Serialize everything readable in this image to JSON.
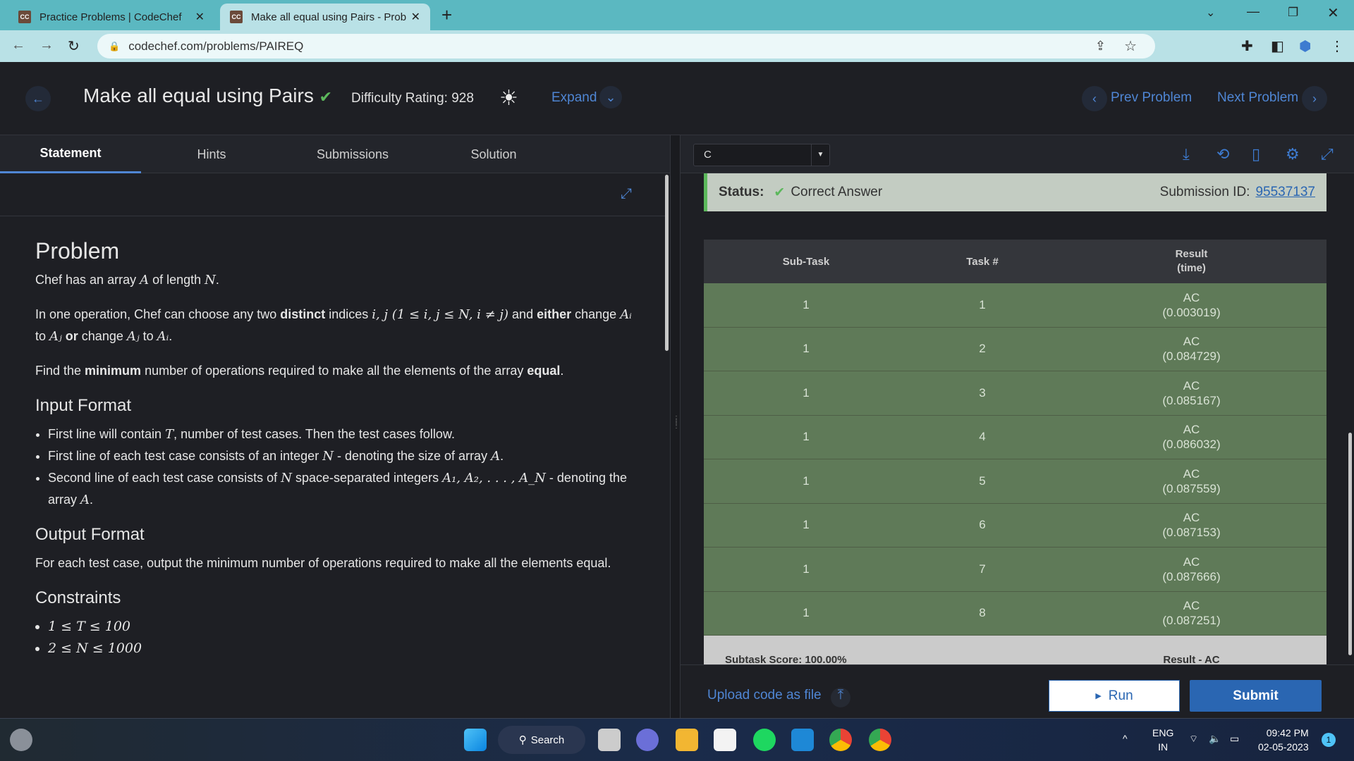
{
  "browser": {
    "tabs": [
      {
        "label": "Practice Problems | CodeChef",
        "favicon": "CC"
      },
      {
        "label": "Make all equal using Pairs - Probl",
        "favicon": "CC"
      }
    ],
    "new_tab": "+",
    "url": "codechef.com/problems/PAIREQ",
    "window_controls": [
      "chevron-down",
      "minimize",
      "restore",
      "close"
    ]
  },
  "header": {
    "title": "Make all equal using Pairs",
    "solved": "✔",
    "difficulty": "Difficulty Rating: 928",
    "expand": "Expand",
    "prev": "Prev Problem",
    "next": "Next Problem"
  },
  "left_tabs": [
    {
      "label": "Statement",
      "active": true
    },
    {
      "label": "Hints"
    },
    {
      "label": "Submissions"
    },
    {
      "label": "Solution"
    }
  ],
  "statement": {
    "problem_heading": "Problem",
    "paragraphs": [
      [
        {
          "t": "Chef has an array "
        },
        {
          "t": "A",
          "s": "m"
        },
        {
          "t": " of length "
        },
        {
          "t": "N",
          "s": "m"
        },
        {
          "t": "."
        }
      ],
      [
        {
          "t": "In one operation, Chef can choose any two "
        },
        {
          "t": "distinct",
          "s": "b"
        },
        {
          "t": " indices "
        },
        {
          "t": "i, j (1 ≤ i, j ≤ N, i ≠ j)",
          "s": "m"
        },
        {
          "t": " and "
        },
        {
          "t": "either",
          "s": "b"
        },
        {
          "t": " change "
        },
        {
          "t": "Aᵢ",
          "s": "m"
        },
        {
          "t": " to "
        },
        {
          "t": "Aⱼ",
          "s": "m"
        },
        {
          "t": " "
        },
        {
          "t": "or",
          "s": "b"
        },
        {
          "t": " change "
        },
        {
          "t": "Aⱼ",
          "s": "m"
        },
        {
          "t": " to "
        },
        {
          "t": "Aᵢ",
          "s": "m"
        },
        {
          "t": "."
        }
      ],
      [
        {
          "t": "Find the "
        },
        {
          "t": "minimum",
          "s": "b"
        },
        {
          "t": " number of operations required to make all the elements of the array "
        },
        {
          "t": "equal",
          "s": "b"
        },
        {
          "t": "."
        }
      ]
    ],
    "input_heading": "Input Format",
    "input_items": [
      [
        {
          "t": "First line will contain "
        },
        {
          "t": "T",
          "s": "m"
        },
        {
          "t": ", number of test cases. Then the test cases follow."
        }
      ],
      [
        {
          "t": "First line of each test case consists of an integer "
        },
        {
          "t": "N",
          "s": "m"
        },
        {
          "t": " - denoting the size of array "
        },
        {
          "t": "A",
          "s": "m"
        },
        {
          "t": "."
        }
      ],
      [
        {
          "t": "Second line of each test case consists of "
        },
        {
          "t": "N",
          "s": "m"
        },
        {
          "t": " space-separated integers "
        },
        {
          "t": "A₁, A₂, . . . , A_N",
          "s": "m"
        },
        {
          "t": " - denoting the array "
        },
        {
          "t": "A",
          "s": "m"
        },
        {
          "t": "."
        }
      ]
    ],
    "output_heading": "Output Format",
    "output_text": "For each test case, output the minimum number of operations required to make all the elements equal.",
    "constraints_heading": "Constraints",
    "constraints": [
      "1 ≤ T ≤ 100",
      "2 ≤ N ≤ 1000"
    ]
  },
  "editor": {
    "language": "C"
  },
  "result": {
    "status_label": "Status:",
    "status": "Correct Answer",
    "submission_label": "Submission ID:",
    "submission_id": "95537137",
    "headers": [
      "Sub-Task",
      "Task #",
      "Result\n(time)"
    ],
    "rows": [
      [
        "1",
        "1",
        "AC",
        "(0.003019)"
      ],
      [
        "1",
        "2",
        "AC",
        "(0.084729)"
      ],
      [
        "1",
        "3",
        "AC",
        "(0.085167)"
      ],
      [
        "1",
        "4",
        "AC",
        "(0.086032)"
      ],
      [
        "1",
        "5",
        "AC",
        "(0.087559)"
      ],
      [
        "1",
        "6",
        "AC",
        "(0.087153)"
      ],
      [
        "1",
        "7",
        "AC",
        "(0.087666)"
      ],
      [
        "1",
        "8",
        "AC",
        "(0.087251)"
      ]
    ],
    "score": "Subtask Score: 100.00%",
    "final": "Result - AC"
  },
  "actions": {
    "upload": "Upload code as file",
    "run": "Run",
    "submit": "Submit"
  },
  "taskbar": {
    "search": "Search",
    "lang1": "ENG",
    "lang2": "IN",
    "time": "09:42 PM",
    "date": "02-05-2023",
    "badge": "1"
  },
  "colors": {
    "accent": "#4f86d4",
    "ac_row": "#5f7a58",
    "submit": "#2a66b2"
  }
}
